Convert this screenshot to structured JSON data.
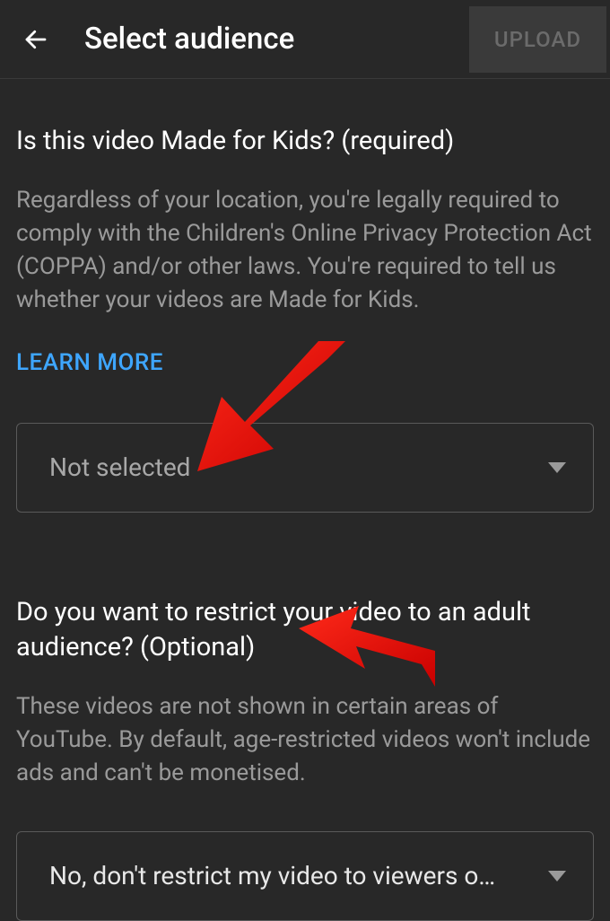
{
  "header": {
    "title": "Select audience",
    "upload_label": "UPLOAD"
  },
  "section1": {
    "heading": "Is this video Made for Kids? (required)",
    "description": "Regardless of your location, you're legally required to comply with the Children's Online Privacy Protection Act (COPPA) and/or other laws. You're required to tell us whether your videos are Made for Kids.",
    "learn_more": "LEARN MORE",
    "dropdown_value": "Not selected"
  },
  "section2": {
    "heading": "Do you want to restrict your video to an adult audience? (Optional)",
    "description": "These videos are not shown in certain areas of YouTube. By default, age-restricted videos won't include ads and can't be monetised.",
    "dropdown_value": "No, don't restrict my video to viewers o…"
  }
}
